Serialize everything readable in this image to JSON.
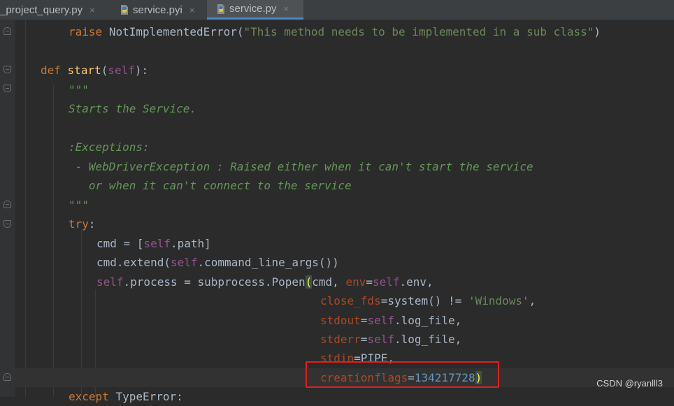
{
  "tabs": [
    {
      "label": "_project_query.py",
      "active": false,
      "icon": "python-file-icon"
    },
    {
      "label": "service.pyi",
      "active": false,
      "icon": "python-stub-file-icon"
    },
    {
      "label": "service.py",
      "active": true,
      "icon": "python-file-icon"
    }
  ],
  "tab_close_glyph": "×",
  "code": {
    "l1": {
      "raise": "raise",
      "err": "NotImplementedError",
      "open": "(",
      "msg": "\"This method needs to be implemented in a sub class\"",
      "close": ")"
    },
    "l2": {
      "def": "def",
      "name": "start",
      "open": "(",
      "self": "self",
      "close": "):"
    },
    "l3": "\"\"\"",
    "l4": "Starts the Service.",
    "l5": ":Exceptions:",
    "l6": " - WebDriverException : Raised either when it can't start the service",
    "l7": "   or when it can't connect to the service",
    "l8": "\"\"\"",
    "l9": {
      "try": "try",
      "colon": ":"
    },
    "l10": {
      "a": "cmd = [",
      "self": "self",
      "b": ".path]"
    },
    "l11": {
      "a": "cmd.extend(",
      "self": "self",
      "b": ".command_line_args())"
    },
    "l12": {
      "self1": "self",
      "a": ".process = subprocess.Popen",
      "paren": "(",
      "b": "cmd, ",
      "kw": "env",
      "eq": "=",
      "self2": "self",
      "c": ".env,"
    },
    "l13": {
      "kw": "close_fds",
      "a": "=system() != ",
      "str": "'Windows'",
      "b": ","
    },
    "l14": {
      "kw": "stdout",
      "eq": "=",
      "self": "self",
      "a": ".log_file,"
    },
    "l15": {
      "kw": "stderr",
      "eq": "=",
      "self": "self",
      "a": ".log_file,"
    },
    "l16": {
      "kw": "stdin",
      "a": "=PIPE,"
    },
    "l17": {
      "kw": "creationflags",
      "eq": "=",
      "num": "134217728",
      "paren": ")"
    },
    "l18": {
      "except": "except",
      "err": "TypeError",
      "colon": ":"
    }
  },
  "colors": {
    "keyword": "#cc7832",
    "function": "#ffc66d",
    "self": "#94558d",
    "string": "#6a8759",
    "docstring": "#629755",
    "kwarg": "#aa4926",
    "number": "#6897bb",
    "annotation_box": "#e01f1f",
    "active_tab_underline": "#4a88c7"
  },
  "watermark": "CSDN @ryanlll3"
}
